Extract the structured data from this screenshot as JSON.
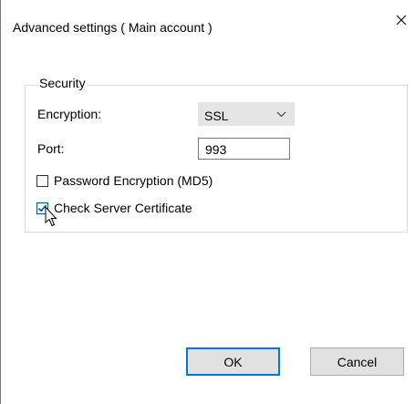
{
  "window": {
    "title": "Advanced settings ( Main account )"
  },
  "security": {
    "group_label": "Security",
    "encryption_label": "Encryption:",
    "encryption_value": "SSL",
    "port_label": "Port:",
    "port_value": "993",
    "password_encryption_label": "Password Encryption (MD5)",
    "password_encryption_checked": false,
    "check_certificate_label": "Check Server Certificate",
    "check_certificate_checked": true
  },
  "buttons": {
    "ok": "OK",
    "cancel": "Cancel"
  },
  "icons": [
    "close-icon",
    "chevron-down-icon",
    "checkmark-icon",
    "mouse-pointer-icon"
  ],
  "colors": {
    "default_button_border": "#0078d7",
    "checkbox_accent": "#005499"
  }
}
